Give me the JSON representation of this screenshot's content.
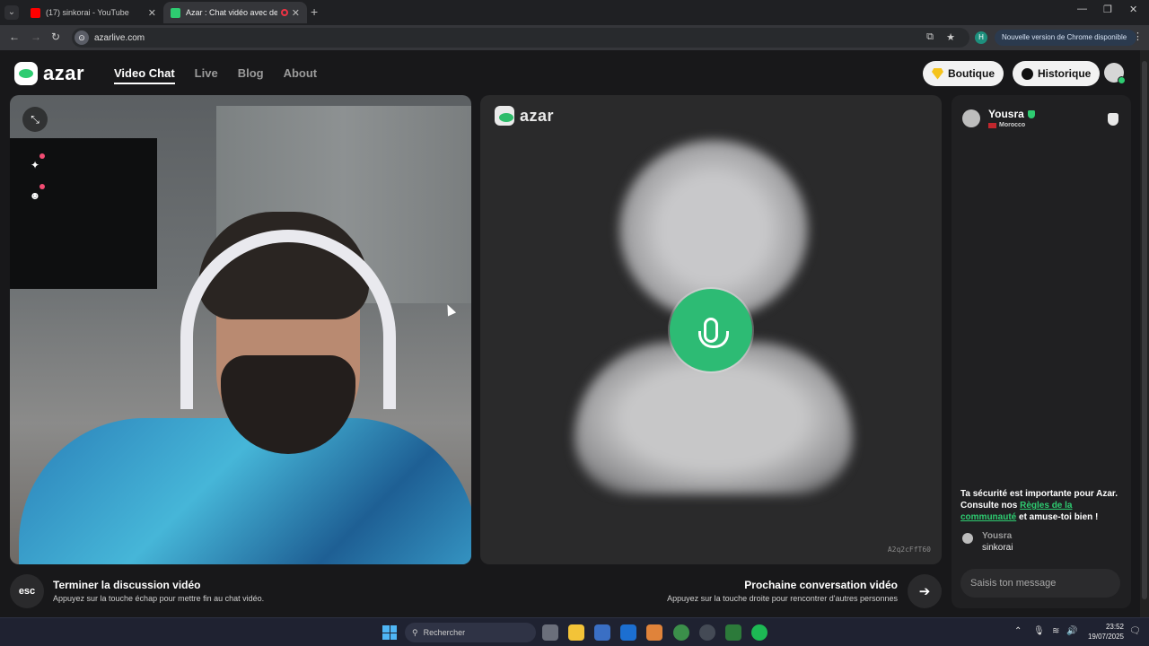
{
  "browser": {
    "tabs": [
      {
        "title": "(17) sinkorai - YouTube",
        "favicon_color": "#ff0000"
      },
      {
        "title": "Azar : Chat vidéo avec de n",
        "favicon_color": "#2ecc71"
      }
    ],
    "new_tab_symbol": "+",
    "url": "azarlive.com",
    "profile_initial": "H",
    "update_label": "Nouvelle version de Chrome disponible"
  },
  "header": {
    "logo_text": "azar",
    "nav": [
      "Video Chat",
      "Live",
      "Blog",
      "About"
    ],
    "active_nav": "Video Chat",
    "boutique_label": "Boutique",
    "historique_label": "Historique"
  },
  "remote": {
    "logo_text": "azar",
    "code": "A2q2cFfT60"
  },
  "controls": {
    "esc_key": "esc",
    "end_title": "Terminer la discussion vidéo",
    "end_sub": "Appuyez sur la touche échap pour mettre fin au chat vidéo.",
    "next_title": "Prochaine conversation vidéo",
    "next_sub": "Appuyez sur la touche droite pour rencontrer d'autres personnes",
    "next_icon": "arrow-right-icon"
  },
  "chat": {
    "partner_name": "Yousra",
    "partner_country": "Morocco",
    "safety_before": "Ta sécurité est importante pour Azar. Consulte nos ",
    "safety_link": "Règles de la communauté",
    "safety_after": " et amuse-toi bien !",
    "messages": [
      {
        "author": "Yousra",
        "text": "sinkorai"
      }
    ],
    "input_placeholder": "Saisis ton message"
  },
  "taskbar": {
    "search_label": "Rechercher",
    "time": "23:52",
    "date": "19/07/2025"
  },
  "colors": {
    "accent": "#2ecc71",
    "mic_button": "#2dbb74"
  }
}
